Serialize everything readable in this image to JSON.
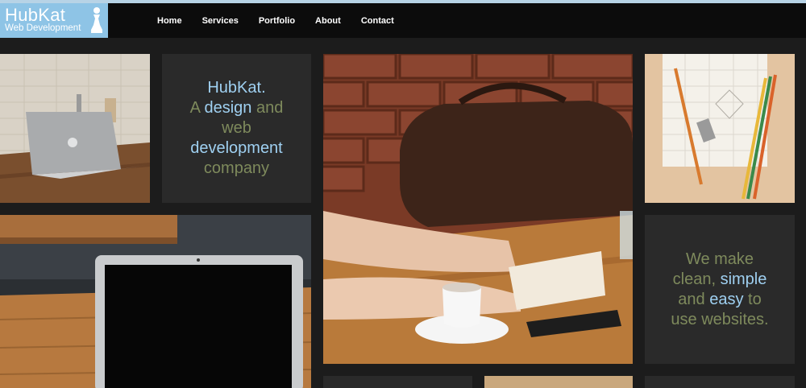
{
  "brand": {
    "title": "HubKat",
    "subtitle": "Web Development",
    "logo_icon": "chess-pawn-icon"
  },
  "nav": [
    {
      "label": "Home"
    },
    {
      "label": "Services"
    },
    {
      "label": "Portfolio"
    },
    {
      "label": "About"
    },
    {
      "label": "Contact"
    }
  ],
  "tagline1": {
    "line1": "HubKat.",
    "line2_a": "A ",
    "line2_b": "design",
    "line2_c": " and",
    "line3": "web",
    "line4": "development",
    "line5": "company"
  },
  "tagline2": {
    "line1": "We make",
    "line2_a": "clean, ",
    "line2_b": "simple",
    "line3_a": "and ",
    "line3_b": "easy",
    "line3_c": " to",
    "line4": "use websites."
  },
  "colors": {
    "accent": "#8ec4e6",
    "olive_text": "#7e8a5c",
    "blue_text": "#9fd0f1",
    "panel": "#2a2a2a"
  }
}
